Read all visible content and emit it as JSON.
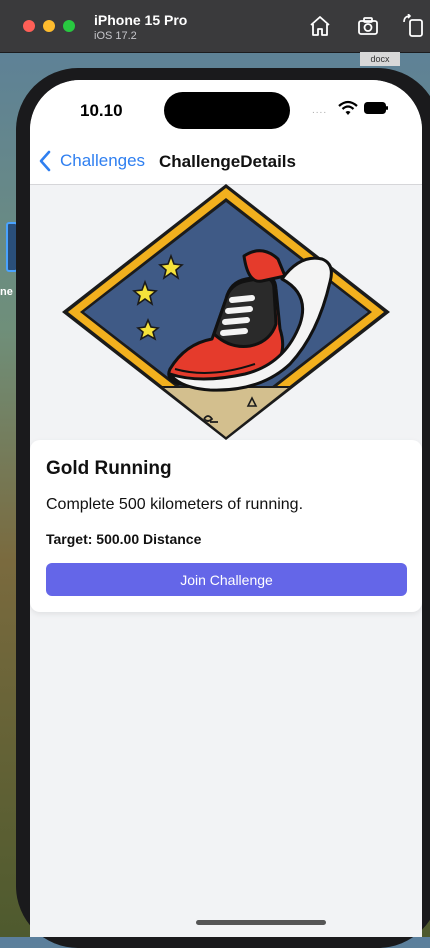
{
  "simulator": {
    "device": "iPhone 15 Pro",
    "os": "iOS 17.2",
    "icons": [
      "home-icon",
      "screenshot-icon",
      "rotate-icon"
    ]
  },
  "desktop": {
    "file_chip": "docx",
    "edge_label": "ne"
  },
  "status_bar": {
    "time": "10.10",
    "signal": "...."
  },
  "nav": {
    "back_label": "Challenges",
    "title": "ChallengeDetails"
  },
  "challenge": {
    "badge_image": "gold-running-shoe-badge",
    "title": "Gold Running",
    "description": "Complete 500 kilometers of running.",
    "target": "Target: 500.00 Distance",
    "join_label": "Join Challenge"
  },
  "colors": {
    "accent": "#6466e8",
    "link": "#2f7ff0",
    "badge_border": "#f2b01e",
    "badge_bg": "#3f5a86"
  }
}
